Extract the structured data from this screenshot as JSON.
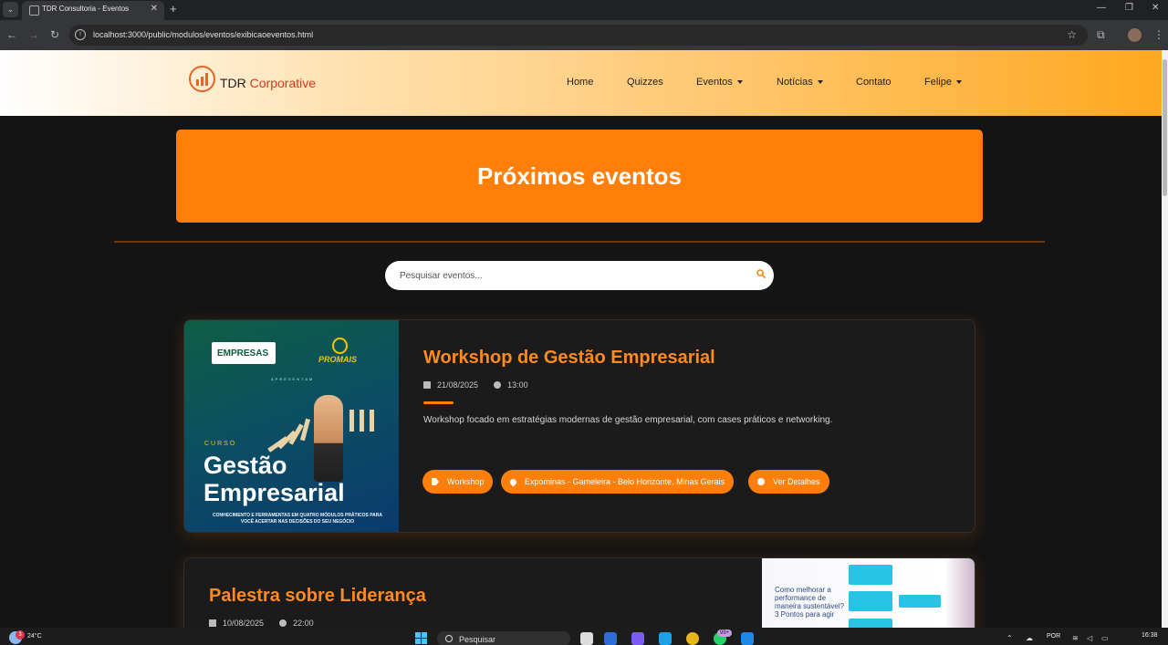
{
  "browser": {
    "tab_title": "TDR Consultoria - Eventos",
    "url": "localhost:3000/public/modulos/eventos/exibicaoeventos.html"
  },
  "navbar": {
    "brand_name": "TDR",
    "brand_accent": "Corporative",
    "links": {
      "home": "Home",
      "quizzes": "Quizzes",
      "eventos": "Eventos",
      "noticias": "Notícias",
      "contato": "Contato",
      "user": "Felipe"
    }
  },
  "hero": {
    "title": "Próximos eventos"
  },
  "search": {
    "placeholder": "Pesquisar eventos..."
  },
  "events": [
    {
      "title": "Workshop de Gestão Empresarial",
      "date": "21/08/2025",
      "time": "13:00",
      "description": "Workshop focado em estratégias modernas de gestão empresarial, com cases práticos e networking.",
      "category": "Workshop",
      "location": "Expominas - Gameleira - Belo Horizonte, Minas Gerais",
      "details_label": "Ver Detalhes",
      "poster": {
        "badge": "EMPRESAS",
        "partner": "PROMAIS",
        "presents": "APRESENTAM",
        "course": "CURSO",
        "title_line1": "Gestão",
        "title_line2": "Empresarial",
        "subtitle": "CONHECIMENTO E FERRAMENTAS EM QUATRO MÓDULOS PRÁTICOS PARA VOCÊ ACERTAR NAS DECISÕES DO SEU NEGÓCIO"
      }
    },
    {
      "title": "Palestra sobre Liderança",
      "date": "10/08/2025",
      "time": "22:00",
      "slide_text": "Como melhorar a performance de maneira sustentável? 3 Pontos para agir"
    }
  ],
  "taskbar": {
    "temperature": "24°C",
    "weather_badge": "3",
    "search_label": "Pesquisar",
    "notif_badge": "99+",
    "language": "POR",
    "time": "16:38"
  },
  "colors": {
    "accent": "#ff7f0a",
    "title_orange": "#ff8a1f",
    "background": "#141414"
  }
}
